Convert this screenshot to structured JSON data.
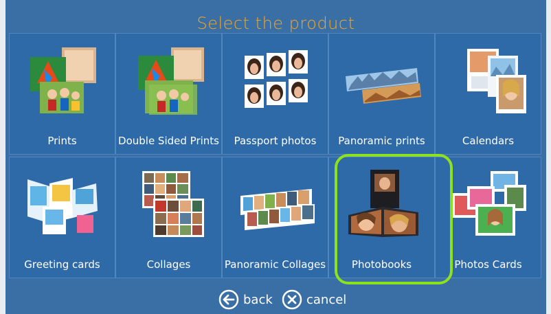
{
  "header": {
    "title": "Select the product"
  },
  "products": [
    {
      "label": "Prints",
      "icon": "prints-icon"
    },
    {
      "label": "Double Sided Prints",
      "icon": "double-sided-prints-icon"
    },
    {
      "label": "Passport photos",
      "icon": "passport-photos-icon"
    },
    {
      "label": "Panoramic prints",
      "icon": "panoramic-prints-icon"
    },
    {
      "label": "Calendars",
      "icon": "calendars-icon"
    },
    {
      "label": "Greeting cards",
      "icon": "greeting-cards-icon"
    },
    {
      "label": "Collages",
      "icon": "collages-icon"
    },
    {
      "label": "Panoramic Collages",
      "icon": "panoramic-collages-icon"
    },
    {
      "label": "Photobooks",
      "icon": "photobooks-icon",
      "selected": true
    },
    {
      "label": "Photos Cards",
      "icon": "photos-cards-icon"
    }
  ],
  "footer": {
    "back_label": "back",
    "cancel_label": "cancel",
    "back_icon": "arrow-left-circle-icon",
    "cancel_icon": "x-circle-icon"
  },
  "colors": {
    "background": "#3a6fa6",
    "tile": "#2f6aa8",
    "title": "#f5a623",
    "selection": "#8ee11f"
  }
}
